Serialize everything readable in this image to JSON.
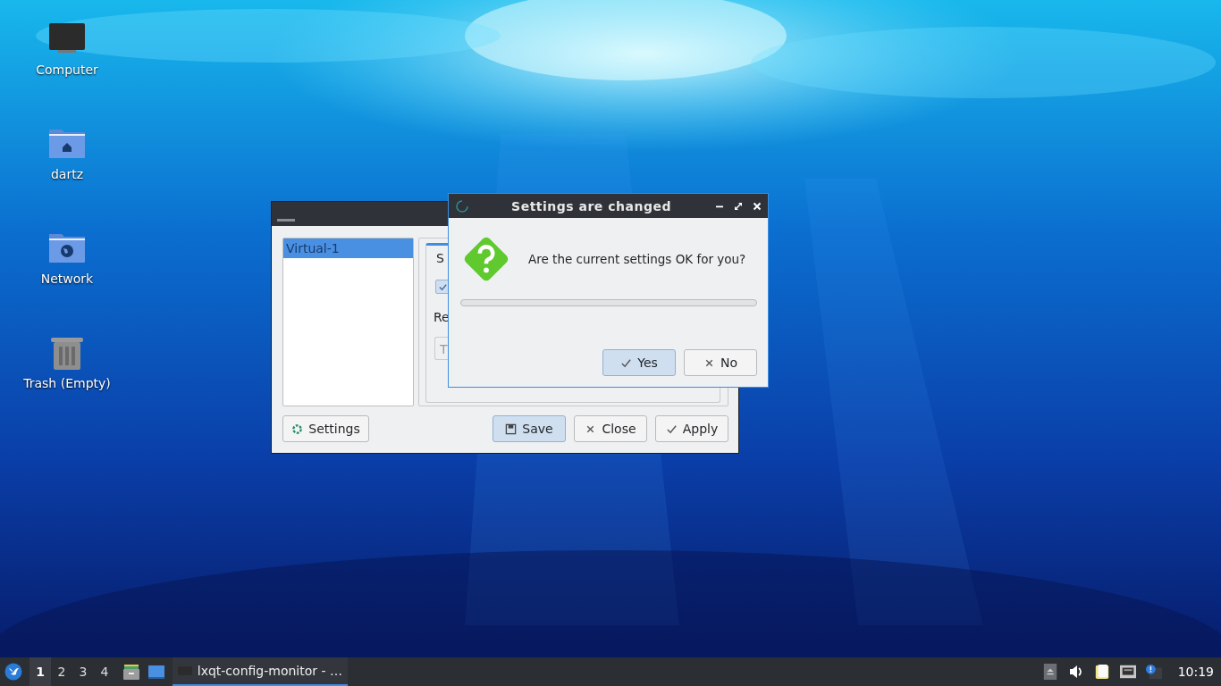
{
  "desktop_icons": [
    {
      "label": "Computer",
      "kind": "computer"
    },
    {
      "label": "dartz",
      "kind": "home"
    },
    {
      "label": "Network",
      "kind": "network"
    },
    {
      "label": "Trash (Empty)",
      "kind": "trash"
    }
  ],
  "config_window": {
    "devices": [
      {
        "label": "Virtual-1",
        "selected": true
      }
    ],
    "tab": "S",
    "checkbox": {
      "checked": true
    },
    "label": "Re",
    "field": {
      "value": "T"
    },
    "buttons": [
      {
        "label": "Settings",
        "kind": "settings",
        "default": false
      },
      {
        "label": "Save",
        "kind": "save",
        "default": true
      },
      {
        "label": "Close",
        "kind": "close",
        "default": false
      },
      {
        "label": "Apply",
        "kind": "apply",
        "default": false
      }
    ]
  },
  "dialog": {
    "title": "Settings are changed",
    "message": "Are the current settings OK for you?",
    "progress": {
      "level": 0
    },
    "buttons": [
      {
        "label": "Yes",
        "kind": "yes",
        "default": true
      },
      {
        "label": "No",
        "kind": "no",
        "default": false
      }
    ]
  },
  "taskbar": {
    "desktops": [
      {
        "label": "1",
        "selected": true
      },
      {
        "label": "2",
        "selected": false
      },
      {
        "label": "3",
        "selected": false
      },
      {
        "label": "4",
        "selected": false
      }
    ],
    "task": {
      "label": "lxqt-config-monitor - …",
      "selected": true
    },
    "clock": "10:19"
  }
}
